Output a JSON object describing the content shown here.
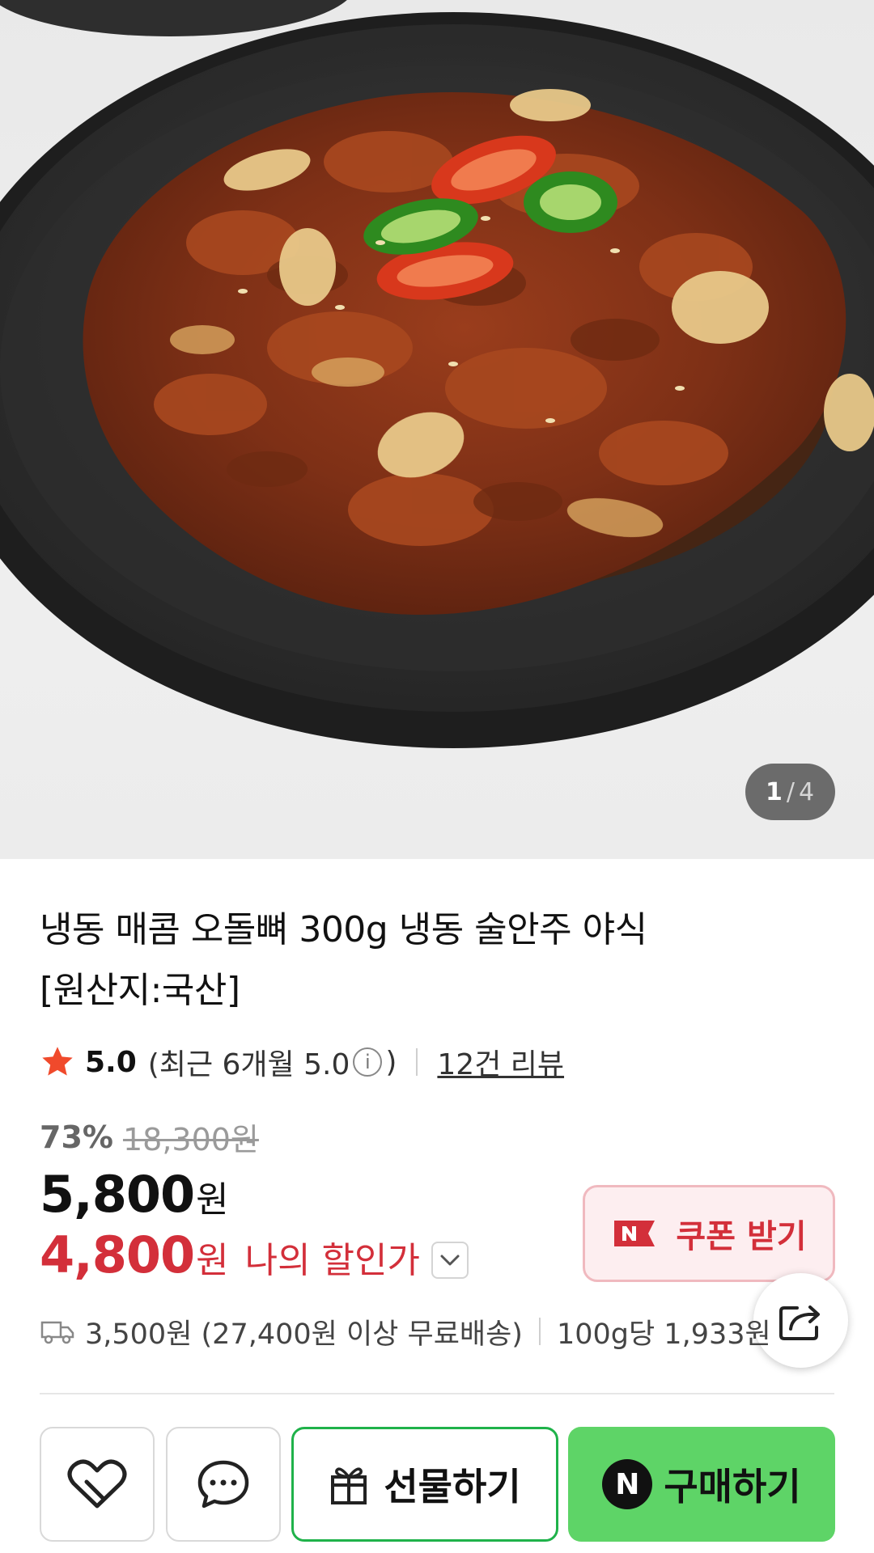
{
  "gallery": {
    "current": "1",
    "separator": "/",
    "total": "4"
  },
  "product": {
    "title_line1": "냉동 매콤 오돌뼈 300g 냉동 술안주 야식",
    "title_line2": "[원산지:국산]"
  },
  "rating": {
    "score": "5.0",
    "recent_prefix": "(최근 6개월 5.0",
    "recent_suffix": ")",
    "reviews": "12건 리뷰"
  },
  "pricing": {
    "discount_pct": "73%",
    "original": "18,300원",
    "sale_amount": "5,800",
    "currency": "원",
    "my_amount": "4,800",
    "my_label": "나의 할인가"
  },
  "coupon": {
    "label": "쿠폰 받기"
  },
  "shipping": {
    "fee": "3,500원 (27,400원 이상 무료배송)",
    "unit_price": "100g당 1,933원"
  },
  "actions": {
    "gift_label": "선물하기",
    "buy_label": "구매하기",
    "buy_logo": "N"
  },
  "colors": {
    "sale_red": "#d32f3a",
    "coupon_bg": "#fdeef0",
    "buy_green": "#5ed467",
    "gift_border": "#1fb24a"
  },
  "icons": [
    "star-icon",
    "info-icon",
    "chevron-down-icon",
    "naver-pay-badge-icon",
    "share-icon",
    "truck-icon",
    "heart-icon",
    "chat-icon",
    "gift-icon",
    "naver-logo-icon"
  ]
}
